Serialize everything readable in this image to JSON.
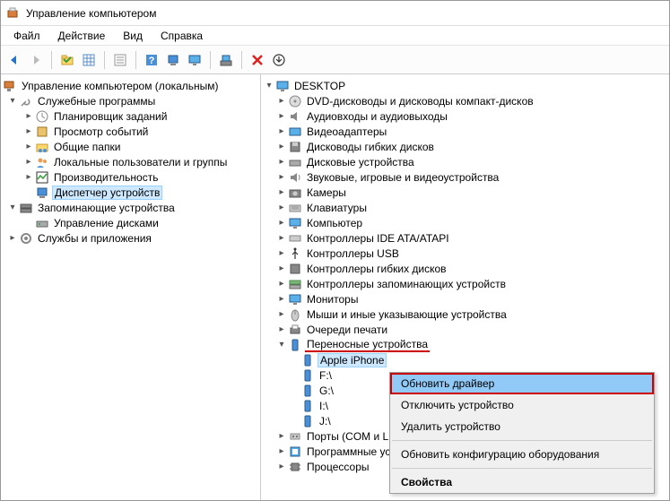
{
  "titlebar": {
    "title": "Управление компьютером"
  },
  "menubar": {
    "items": [
      "Файл",
      "Действие",
      "Вид",
      "Справка"
    ]
  },
  "left_tree": {
    "root": "Управление компьютером (локальным)",
    "system_tools": "Служебные программы",
    "task_scheduler": "Планировщик заданий",
    "event_viewer": "Просмотр событий",
    "shared_folders": "Общие папки",
    "local_users": "Локальные пользователи и группы",
    "performance": "Производительность",
    "device_manager": "Диспетчер устройств",
    "storage": "Запоминающие устройства",
    "disk_mgmt": "Управление дисками",
    "services": "Службы и приложения"
  },
  "right_tree": {
    "root": "DESKTOP",
    "items": {
      "dvd": "DVD-дисководы и дисководы компакт-дисков",
      "audio": "Аудиовходы и аудиовыходы",
      "video": "Видеоадаптеры",
      "floppy": "Дисководы гибких дисков",
      "disks": "Дисковые устройства",
      "sound": "Звуковые, игровые и видеоустройства",
      "cameras": "Камеры",
      "keyboards": "Клавиатуры",
      "computer": "Компьютер",
      "ide": "Контроллеры IDE ATA/ATAPI",
      "usb": "Контроллеры USB",
      "floppy_ctrl": "Контроллеры гибких дисков",
      "storage_ctrl": "Контроллеры запоминающих устройств",
      "monitors": "Мониторы",
      "mice": "Мыши и иные указывающие устройства",
      "print_queues": "Очереди печати",
      "portable": "Переносные устройства",
      "apple": "Apple iPhone",
      "f": "F:\\",
      "g": "G:\\",
      "i": "I:\\",
      "j": "J:\\",
      "ports": "Порты (COM и L",
      "software": "Программные ус",
      "processors": "Процессоры"
    }
  },
  "context_menu": {
    "update": "Обновить драйвер",
    "disable": "Отключить устройство",
    "remove": "Удалить устройство",
    "scan": "Обновить конфигурацию оборудования",
    "properties": "Свойства"
  }
}
